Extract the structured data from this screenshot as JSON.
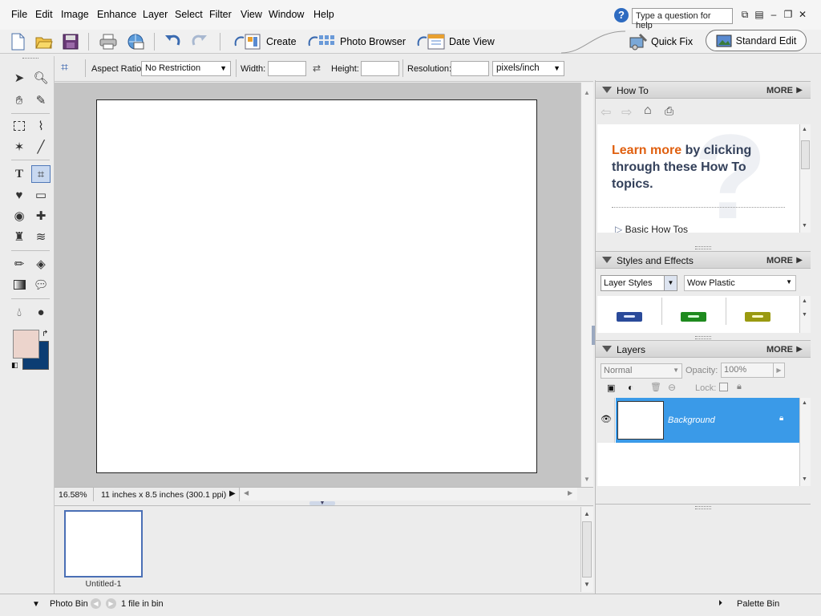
{
  "menu": {
    "items": [
      "File",
      "Edit",
      "Image",
      "Enhance",
      "Layer",
      "Select",
      "Filter",
      "View",
      "Window",
      "Help"
    ],
    "help_placeholder": "Type a question for help"
  },
  "shortcuts": {
    "create": "Create",
    "photo_browser": "Photo Browser",
    "date_view": "Date View",
    "quick_fix": "Quick Fix",
    "standard_edit": "Standard Edit"
  },
  "options": {
    "aspect_ratio_label": "Aspect Ratio:",
    "aspect_ratio_value": "No Restriction",
    "width_label": "Width:",
    "width_value": "",
    "height_label": "Height:",
    "height_value": "",
    "resolution_label": "Resolution:",
    "resolution_value": "",
    "resolution_unit": "pixels/inch"
  },
  "status": {
    "zoom": "16.58%",
    "doc_info": "11 inches x 8.5 inches (300.1 ppi)"
  },
  "photo_bin": {
    "thumb_label": "Untitled-1",
    "bin_label": "Photo Bin",
    "file_count": "1 file in bin",
    "palette_bin_label": "Palette Bin"
  },
  "howto": {
    "title": "How To",
    "more": "MORE",
    "headline_accent": "Learn more",
    "headline_rest": "by clicking through these How To topics.",
    "topic": "Basic How Tos",
    "accent_color": "#e06010"
  },
  "styles": {
    "title": "Styles and Effects",
    "more": "MORE",
    "category": "Layer Styles",
    "library": "Wow Plastic",
    "swatch_colors": [
      "#2a4a9a",
      "#1e8a1e",
      "#9a9a10"
    ]
  },
  "layers": {
    "title": "Layers",
    "more": "MORE",
    "blend_mode": "Normal",
    "opacity_label": "Opacity:",
    "opacity_value": "100%",
    "lock_label": "Lock:",
    "layer_name": "Background",
    "selected_color": "#3a9ae8"
  }
}
